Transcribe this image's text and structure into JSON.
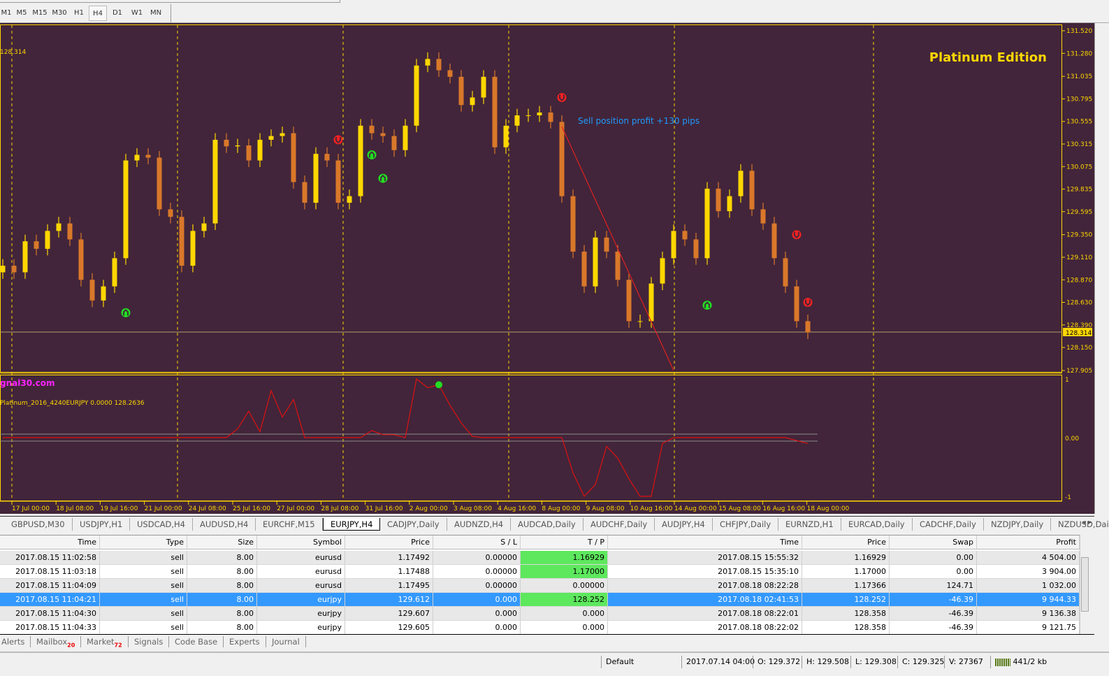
{
  "toolbar": {
    "timeframes": [
      "M1",
      "M5",
      "M15",
      "M30",
      "H1",
      "H4",
      "D1",
      "W1",
      "MN"
    ],
    "active_timeframe": "H4"
  },
  "chart": {
    "symbol_price_label": "128.314",
    "edition_label": "Platinum Edition",
    "site_label": "gnal30.com",
    "sell_note": "Sell position profit +130 pips",
    "indicator_label": "Platinum_2016_4240EURJPY 0.0000 128.2636",
    "current_price": "128.314",
    "colors": {
      "background": "#42253a",
      "bull": "#ffd700",
      "bear": "#d9782a",
      "grid": "#ffd700",
      "signal_up": "#22dd22",
      "signal_down": "#ee2222",
      "indicator": "#dd1111"
    }
  },
  "chart_data": {
    "type": "candlestick",
    "price_axis": {
      "ticks": [
        "131.520",
        "131.280",
        "131.035",
        "130.795",
        "130.555",
        "130.315",
        "130.075",
        "129.835",
        "129.595",
        "129.350",
        "129.110",
        "128.870",
        "128.630",
        "128.390",
        "128.150",
        "127.905"
      ],
      "ylim": [
        127.905,
        131.52
      ]
    },
    "time_axis": [
      "17 Jul 00:00",
      "18 Jul 08:00",
      "19 Jul 16:00",
      "21 Jul 00:00",
      "24 Jul 08:00",
      "25 Jul 16:00",
      "27 Jul 00:00",
      "28 Jul 08:00",
      "31 Jul 16:00",
      "2 Aug 00:00",
      "3 Aug 08:00",
      "4 Aug 16:00",
      "8 Aug 00:00",
      "9 Aug 08:00",
      "10 Aug 16:00",
      "14 Aug 00:00",
      "15 Aug 08:00",
      "16 Aug 16:00",
      "18 Aug 00:00"
    ],
    "closes": [
      128.95,
      129.02,
      128.95,
      129.28,
      129.2,
      129.39,
      129.47,
      129.3,
      128.87,
      128.65,
      128.8,
      129.1,
      130.14,
      130.2,
      130.17,
      129.62,
      129.54,
      129.02,
      129.39,
      129.47,
      130.36,
      130.29,
      130.3,
      130.14,
      130.36,
      130.4,
      130.43,
      129.91,
      129.69,
      130.21,
      130.14,
      129.69,
      129.76,
      130.51,
      130.43,
      130.4,
      130.25,
      130.51,
      131.15,
      131.22,
      131.1,
      131.03,
      130.73,
      130.81,
      131.03,
      130.28,
      130.51,
      130.62,
      130.62,
      130.65,
      130.55,
      129.76,
      129.17,
      128.8,
      129.32,
      129.17,
      128.87,
      128.43,
      128.43,
      128.83,
      129.1,
      129.39,
      129.3,
      129.1,
      129.84,
      129.6,
      129.76,
      130.03,
      129.62,
      129.47,
      129.1,
      128.8,
      128.43,
      128.31
    ],
    "signals": [
      {
        "bar": 30,
        "price": 130.36,
        "dir": "down"
      },
      {
        "bar": 50,
        "price": 130.81,
        "dir": "down"
      },
      {
        "bar": 71,
        "price": 129.35,
        "dir": "down"
      },
      {
        "bar": 72,
        "price": 128.63,
        "dir": "down"
      },
      {
        "bar": 11,
        "price": 128.52,
        "dir": "up"
      },
      {
        "bar": 33,
        "price": 130.2,
        "dir": "up"
      },
      {
        "bar": 34,
        "price": 129.95,
        "dir": "up"
      },
      {
        "bar": 63,
        "price": 128.6,
        "dir": "up"
      }
    ],
    "trend_line": [
      {
        "bar": 50,
        "price": 130.5
      },
      {
        "bar": 60,
        "price": 127.905
      }
    ],
    "indicator": {
      "ylim": [
        -1,
        1
      ],
      "ticks": [
        "1",
        "0.00",
        "-1"
      ],
      "values": [
        0,
        0,
        0,
        0,
        0,
        0,
        0,
        0,
        0,
        0,
        0,
        0,
        0,
        0,
        0,
        0,
        0,
        0,
        0,
        0,
        0,
        0.15,
        0.45,
        0.1,
        0.8,
        0.35,
        0.65,
        0,
        0,
        0,
        0,
        0,
        0,
        0.12,
        0.05,
        0.05,
        0,
        1,
        0.85,
        0.9,
        0.55,
        0.25,
        0.02,
        0,
        0,
        0,
        0,
        0,
        0,
        0,
        0,
        -0.6,
        -1,
        -0.8,
        -0.15,
        -0.35,
        -0.7,
        -1,
        -1,
        -0.1,
        0,
        0,
        0,
        0,
        0,
        0,
        0,
        0,
        0,
        0,
        0,
        -0.05,
        -0.1
      ],
      "dot_bar": 39,
      "dot_value": 0.9
    }
  },
  "chart_tabs": [
    "GBPUSD,M30",
    "USDJPY,H1",
    "USDCAD,H4",
    "AUDUSD,H4",
    "EURCHF,M15",
    "EURJPY,H4",
    "CADJPY,Daily",
    "AUDNZD,H4",
    "AUDCAD,Daily",
    "AUDCHF,Daily",
    "AUDJPY,H4",
    "CHFJPY,Daily",
    "EURNZD,H1",
    "EURCAD,Daily",
    "CADCHF,Daily",
    "NZDJPY,Daily",
    "NZDUSD,Daily"
  ],
  "active_chart_tab": "EURJPY,H4",
  "table": {
    "headers": [
      "Time",
      "Type",
      "Size",
      "Symbol",
      "Price",
      "S / L",
      "T / P",
      "Time",
      "Price",
      "Swap",
      "Profit"
    ],
    "rows": [
      [
        "2017.08.15 11:02:58",
        "sell",
        "8.00",
        "eurusd",
        "1.17492",
        "0.00000",
        "1.16929",
        "2017.08.15 15:55:32",
        "1.16929",
        "0.00",
        "4 504.00"
      ],
      [
        "2017.08.15 11:03:18",
        "sell",
        "8.00",
        "eurusd",
        "1.17488",
        "0.00000",
        "1.17000",
        "2017.08.15 15:35:10",
        "1.17000",
        "0.00",
        "3 904.00"
      ],
      [
        "2017.08.15 11:04:09",
        "sell",
        "8.00",
        "eurusd",
        "1.17495",
        "0.00000",
        "0.00000",
        "2017.08.18 08:22:28",
        "1.17366",
        "124.71",
        "1 032.00"
      ],
      [
        "2017.08.15 11:04:21",
        "sell",
        "8.00",
        "eurjpy",
        "129.612",
        "0.000",
        "128.252",
        "2017.08.18 02:41:53",
        "128.252",
        "-46.39",
        "9 944.33"
      ],
      [
        "2017.08.15 11:04:30",
        "sell",
        "8.00",
        "eurjpy",
        "129.607",
        "0.000",
        "0.000",
        "2017.08.18 08:22:01",
        "128.358",
        "-46.39",
        "9 136.38"
      ],
      [
        "2017.08.15 11:04:33",
        "sell",
        "8.00",
        "eurjpy",
        "129.605",
        "0.000",
        "0.000",
        "2017.08.18 08:22:02",
        "128.358",
        "-46.39",
        "9 121.75"
      ]
    ],
    "tp_hit_rows": [
      0,
      1,
      3
    ],
    "selected_row": 3
  },
  "bottom_tabs": [
    {
      "label": "Alerts",
      "badge": ""
    },
    {
      "label": "Mailbox",
      "badge": "20"
    },
    {
      "label": "Market",
      "badge": "72"
    },
    {
      "label": "Signals",
      "badge": ""
    },
    {
      "label": "Code Base",
      "badge": ""
    },
    {
      "label": "Experts",
      "badge": ""
    },
    {
      "label": "Journal",
      "badge": ""
    }
  ],
  "status": {
    "profile": "Default",
    "datetime": "2017.07.14 04:00",
    "open": "O: 129.372",
    "high": "H: 129.508",
    "low": "L: 129.308",
    "close": "C: 129.325",
    "volume": "V: 27367",
    "traffic": "441/2 kb"
  }
}
